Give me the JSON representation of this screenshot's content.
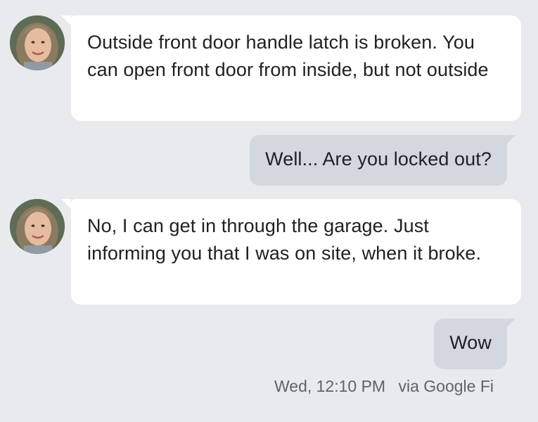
{
  "messages": [
    {
      "direction": "incoming",
      "text": "Outside front door handle latch is broken. You can open front door from inside, but not outside"
    },
    {
      "direction": "outgoing",
      "text": "Well... Are you locked out?"
    },
    {
      "direction": "incoming",
      "text": "No, I can get in through the garage. Just informing you that I was on site, when it broke."
    },
    {
      "direction": "outgoing",
      "text": "Wow"
    }
  ],
  "last_message_meta": {
    "timestamp": "Wed, 12:10 PM",
    "via": "via Google Fi"
  },
  "colors": {
    "background": "#e8eaed",
    "incoming_bubble": "#ffffff",
    "outgoing_bubble": "#d3d8de",
    "text": "#202124",
    "meta_text": "#5f6368"
  }
}
